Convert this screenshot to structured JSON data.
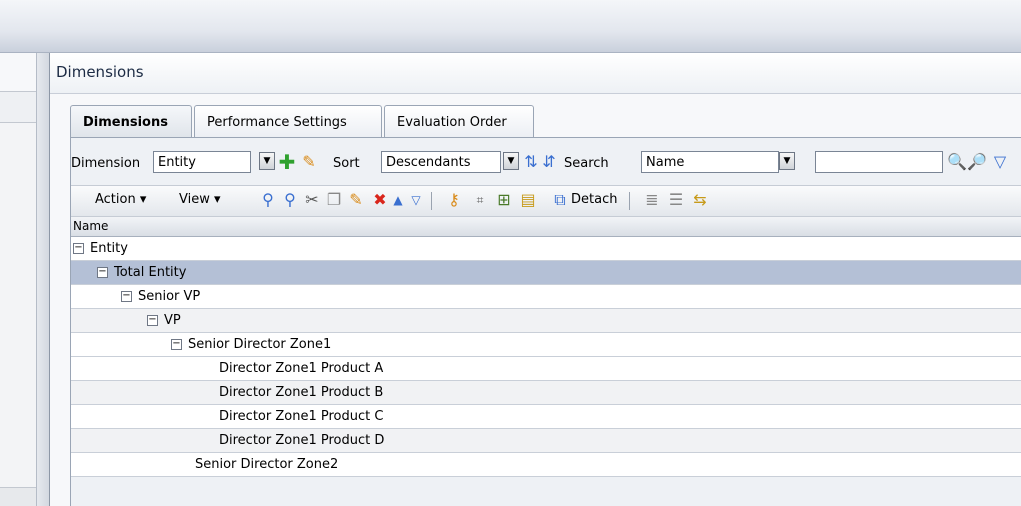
{
  "panel": {
    "title": "Dimensions"
  },
  "tabs": [
    {
      "label": "Dimensions"
    },
    {
      "label": "Performance Settings"
    },
    {
      "label": "Evaluation Order"
    }
  ],
  "toolbar": {
    "dimension_label": "Dimension",
    "dimension_value": "Entity",
    "sort_label": "Sort",
    "sort_value": "Descendants",
    "search_label": "Search",
    "search_field_value": "Name",
    "search_text": ""
  },
  "actions": {
    "action_menu": "Action",
    "view_menu": "View",
    "detach_label": "Detach"
  },
  "grid": {
    "column_header": "Name",
    "toggle_glyph": "−",
    "rows": [
      {
        "label": "Entity"
      },
      {
        "label": "Total Entity"
      },
      {
        "label": "Senior VP"
      },
      {
        "label": "VP"
      },
      {
        "label": "Senior Director Zone1"
      },
      {
        "label": "Director Zone1 Product A"
      },
      {
        "label": "Director Zone1 Product B"
      },
      {
        "label": "Director Zone1 Product C"
      },
      {
        "label": "Director Zone1 Product D"
      },
      {
        "label": "Senior Director Zone2"
      }
    ]
  },
  "colors": {
    "selected_row": "#b4c0d6",
    "add_green": "#2fa12f",
    "delete_red": "#d9261c",
    "pencil": "#d98b1a",
    "arrow_blue": "#3a6fd0"
  },
  "icons": [
    "add-icon",
    "edit-icon",
    "sort-icon",
    "search-icon",
    "filter-icon",
    "cut-icon",
    "copy-icon",
    "delete-icon",
    "move-up-icon",
    "move-down-icon",
    "detach-icon"
  ]
}
